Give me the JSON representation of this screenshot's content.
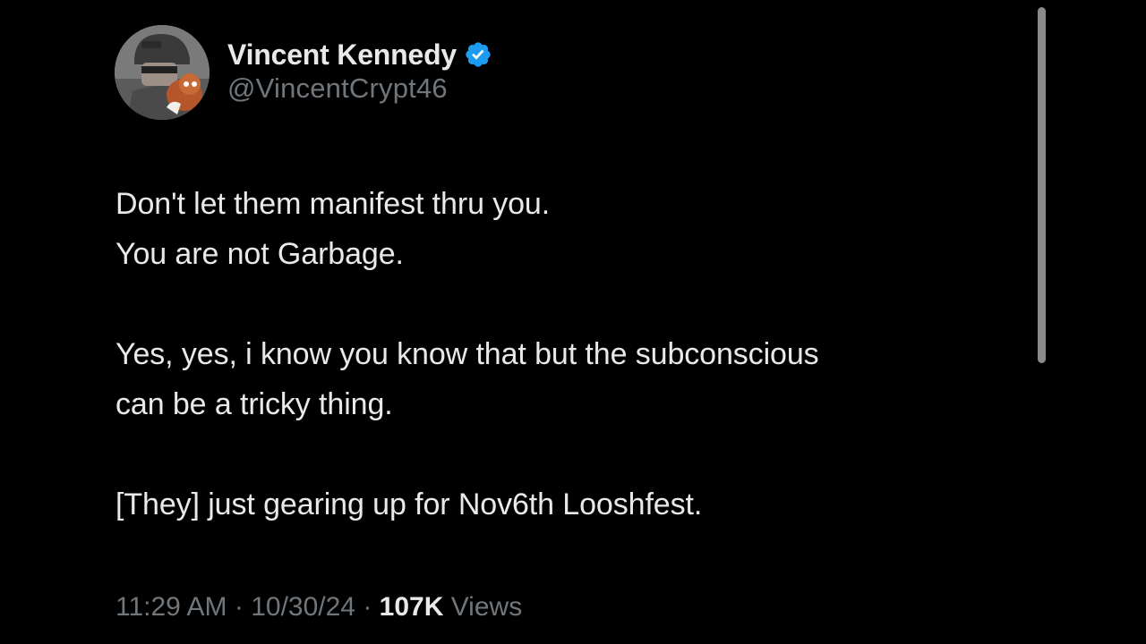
{
  "author": {
    "display_name": "Vincent Kennedy",
    "handle": "@VincentCrypt46",
    "verified": true,
    "verified_color": "#1d9bf0",
    "avatar_icon": "avatar-photo"
  },
  "tweet": {
    "lines": [
      "Don't let them manifest thru you.",
      "You are not Garbage.",
      "",
      "Yes, yes, i know you know that but the subconscious",
      "can be a tricky thing.",
      "",
      "[They] just gearing up for Nov6th Looshfest."
    ]
  },
  "meta": {
    "time": "11:29 AM",
    "separator": " · ",
    "date": "10/30/24",
    "views_count": "107K",
    "views_label": " Views"
  },
  "colors": {
    "background": "#000000",
    "text_primary": "#e7e9ea",
    "text_secondary": "#71767b"
  }
}
